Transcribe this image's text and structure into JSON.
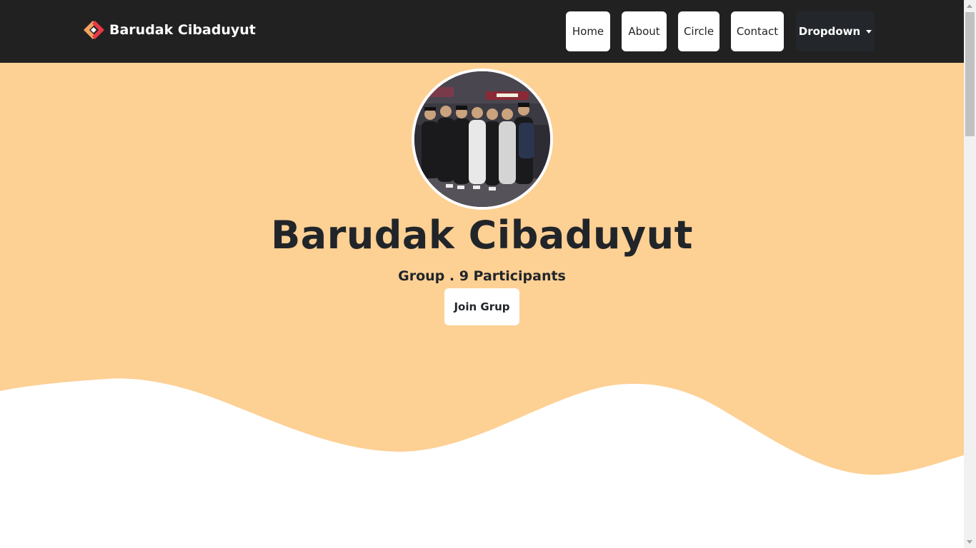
{
  "navbar": {
    "brand": "Barudak Cibaduyut",
    "links": [
      {
        "label": "Home"
      },
      {
        "label": "About"
      },
      {
        "label": "Circle"
      },
      {
        "label": "Contact"
      }
    ],
    "dropdown_label": "Dropdown"
  },
  "hero": {
    "title": "Barudak Cibaduyut",
    "subtitle": "Group . 9 Participants",
    "join_button": "Join Grup"
  },
  "colors": {
    "navbar_bg": "#212121",
    "hero_bg": "#fdd094",
    "dropdown_bg": "#23262b",
    "logo_orange": "#f4a261",
    "logo_red": "#e63946"
  }
}
